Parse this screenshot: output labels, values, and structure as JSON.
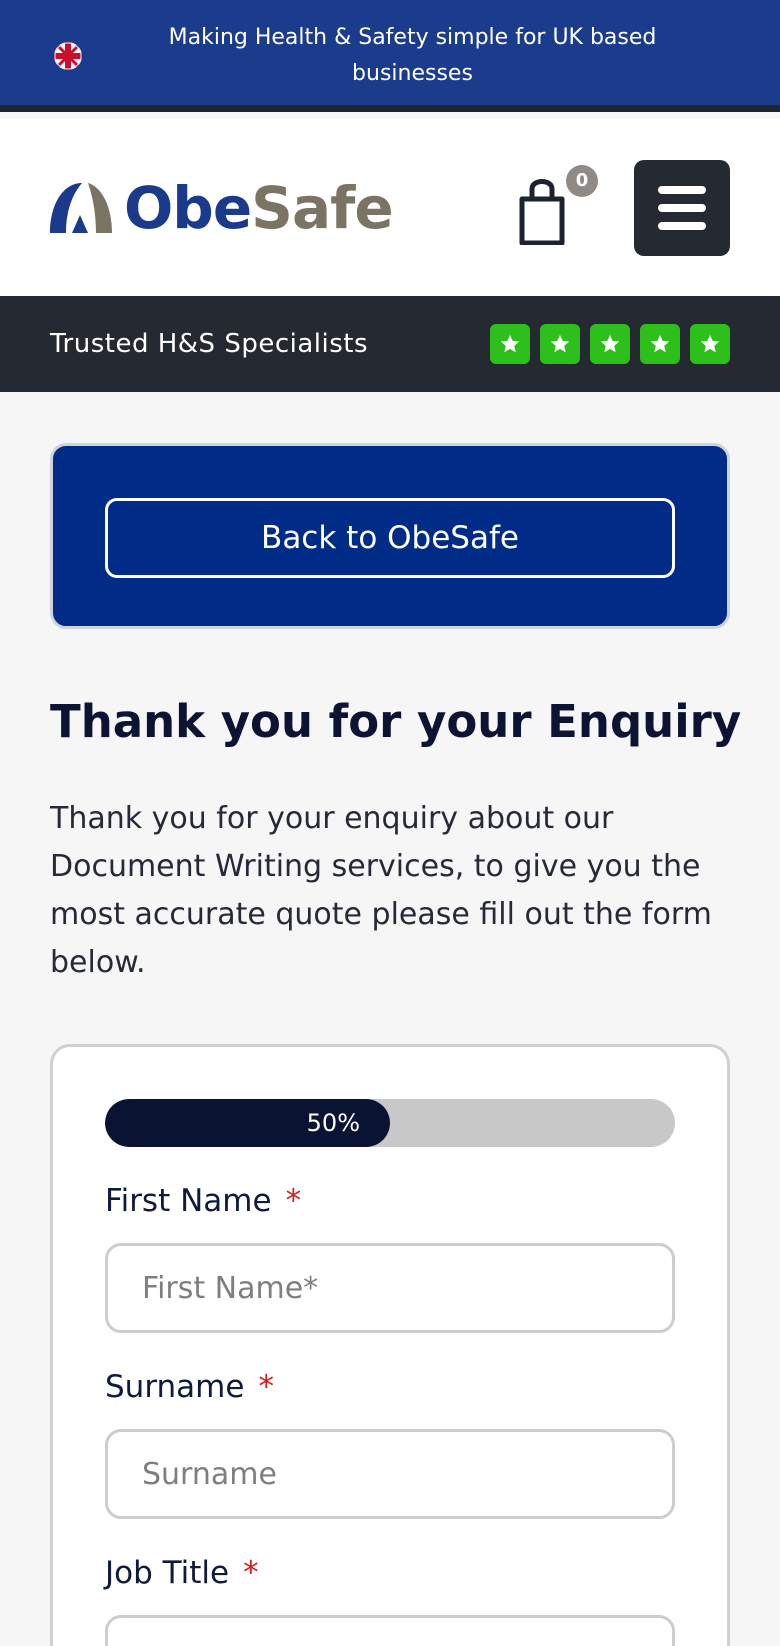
{
  "topbar": {
    "message": "Making Health & Safety simple for UK based businesses",
    "flag_icon": "uk-flag-icon"
  },
  "header": {
    "logo_obe": "Obe",
    "logo_safe": "Safe",
    "cart_count": "0",
    "cart_icon": "shopping-bag-icon",
    "menu_icon": "hamburger-menu-icon"
  },
  "trustbar": {
    "text": "Trusted H&S Specialists",
    "rating": 5,
    "star_icon": "star-icon"
  },
  "back": {
    "label": "Back to ObeSafe"
  },
  "main": {
    "title": "Thank you for your Enquiry",
    "intro": "Thank you for your enquiry about our Document Writing services, to give you the most accurate quote please fill out the form below."
  },
  "form": {
    "progress_label": "50%",
    "progress_value": 0.5,
    "fields": [
      {
        "label": "First Name",
        "required": "*",
        "placeholder": "First Name*",
        "value": ""
      },
      {
        "label": "Surname",
        "required": "*",
        "placeholder": "Surname",
        "value": ""
      },
      {
        "label": "Job Title",
        "required": "*",
        "placeholder": "",
        "value": ""
      }
    ]
  },
  "colors": {
    "topbar": "#1b3c8c",
    "dark": "#252a32",
    "brand_blue": "#002b86",
    "brand_tan": "#7b7363",
    "star_green": "#2ec01a",
    "required_red": "#d51c1c"
  }
}
